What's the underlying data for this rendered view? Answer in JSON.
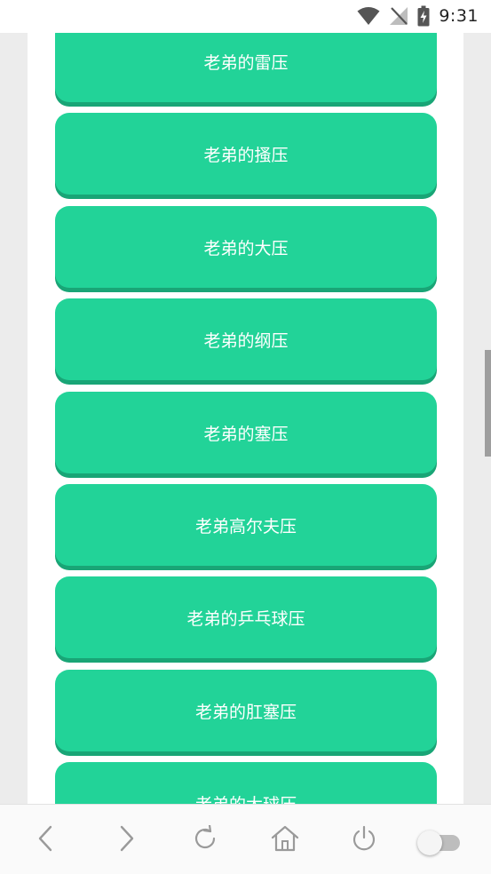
{
  "status_bar": {
    "time": "9:31"
  },
  "buttons": [
    "老弟的雷压",
    "老弟的搔压",
    "老弟的大压",
    "老弟的纲压",
    "老弟的塞压",
    "老弟高尔夫压",
    "老弟的乒乓球压",
    "老弟的肛塞压",
    "老弟的大球压"
  ],
  "bottom_nav": {
    "icons": [
      "back-icon",
      "forward-icon",
      "refresh-icon",
      "home-icon",
      "power-icon"
    ],
    "toggle_state": "off"
  },
  "colors": {
    "button": "#22d398",
    "button_shadow": "#19a576",
    "page_background": "#ececec"
  }
}
